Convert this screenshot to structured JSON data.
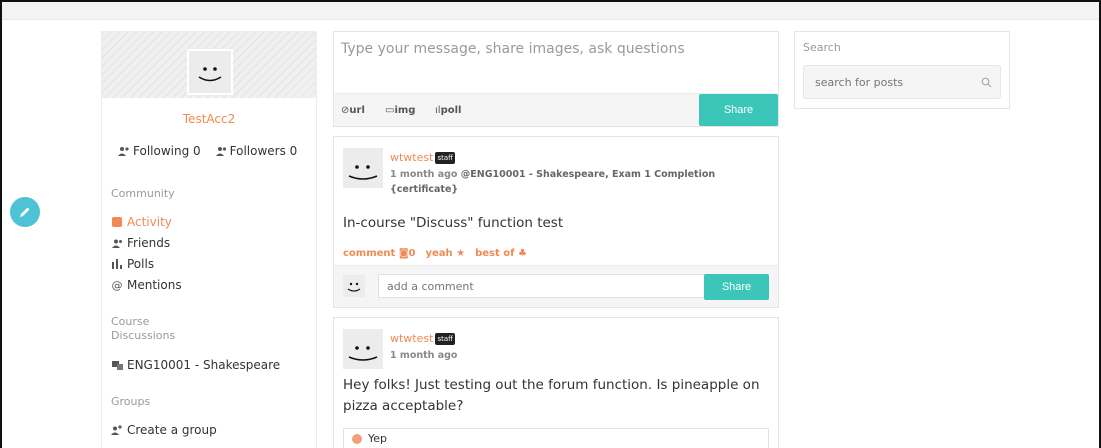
{
  "sidebar": {
    "username": "TestAcc2",
    "following": "Following 0",
    "followers": "Followers 0",
    "community_title": "Community",
    "community_items": [
      {
        "label": "Activity",
        "icon": "activity-icon",
        "active": true
      },
      {
        "label": "Friends",
        "icon": "friends-icon",
        "active": false
      },
      {
        "label": "Polls",
        "icon": "polls-icon",
        "active": false
      },
      {
        "label": "Mentions",
        "icon": "mentions-icon",
        "active": false
      }
    ],
    "course_title_1": "Course",
    "course_title_2": "Discussions",
    "course_items": [
      {
        "label": "ENG10001 - Shakespeare",
        "icon": "course-icon"
      }
    ],
    "groups_title": "Groups",
    "create_group": "Create a group"
  },
  "composer": {
    "placeholder": "Type your message, share images, ask questions",
    "tool_url": "url",
    "tool_img": "img",
    "tool_poll": "poll",
    "share_label": "Share"
  },
  "posts": [
    {
      "author": "wtwtest",
      "badge": "staff",
      "time": "1 month ago",
      "reference": "@ENG10001 - Shakespeare, Exam 1 Completion {certificate}",
      "body": "In-course \"Discuss\" function test",
      "action_comment": "comment",
      "comment_count": "0",
      "action_yeah": "yeah",
      "action_best": "best of",
      "comment_placeholder": "add a comment",
      "share_label": "Share"
    },
    {
      "author": "wtwtest",
      "badge": "staff",
      "time": "1 month ago",
      "body": "Hey folks! Just testing out the forum function. Is pineapple on pizza acceptable?",
      "poll_option": "Yep"
    }
  ],
  "search": {
    "label": "Search",
    "placeholder": "search for posts"
  },
  "colors": {
    "accent": "#f08a52",
    "share": "#3cc5b9",
    "fab": "#4fc3d6"
  }
}
